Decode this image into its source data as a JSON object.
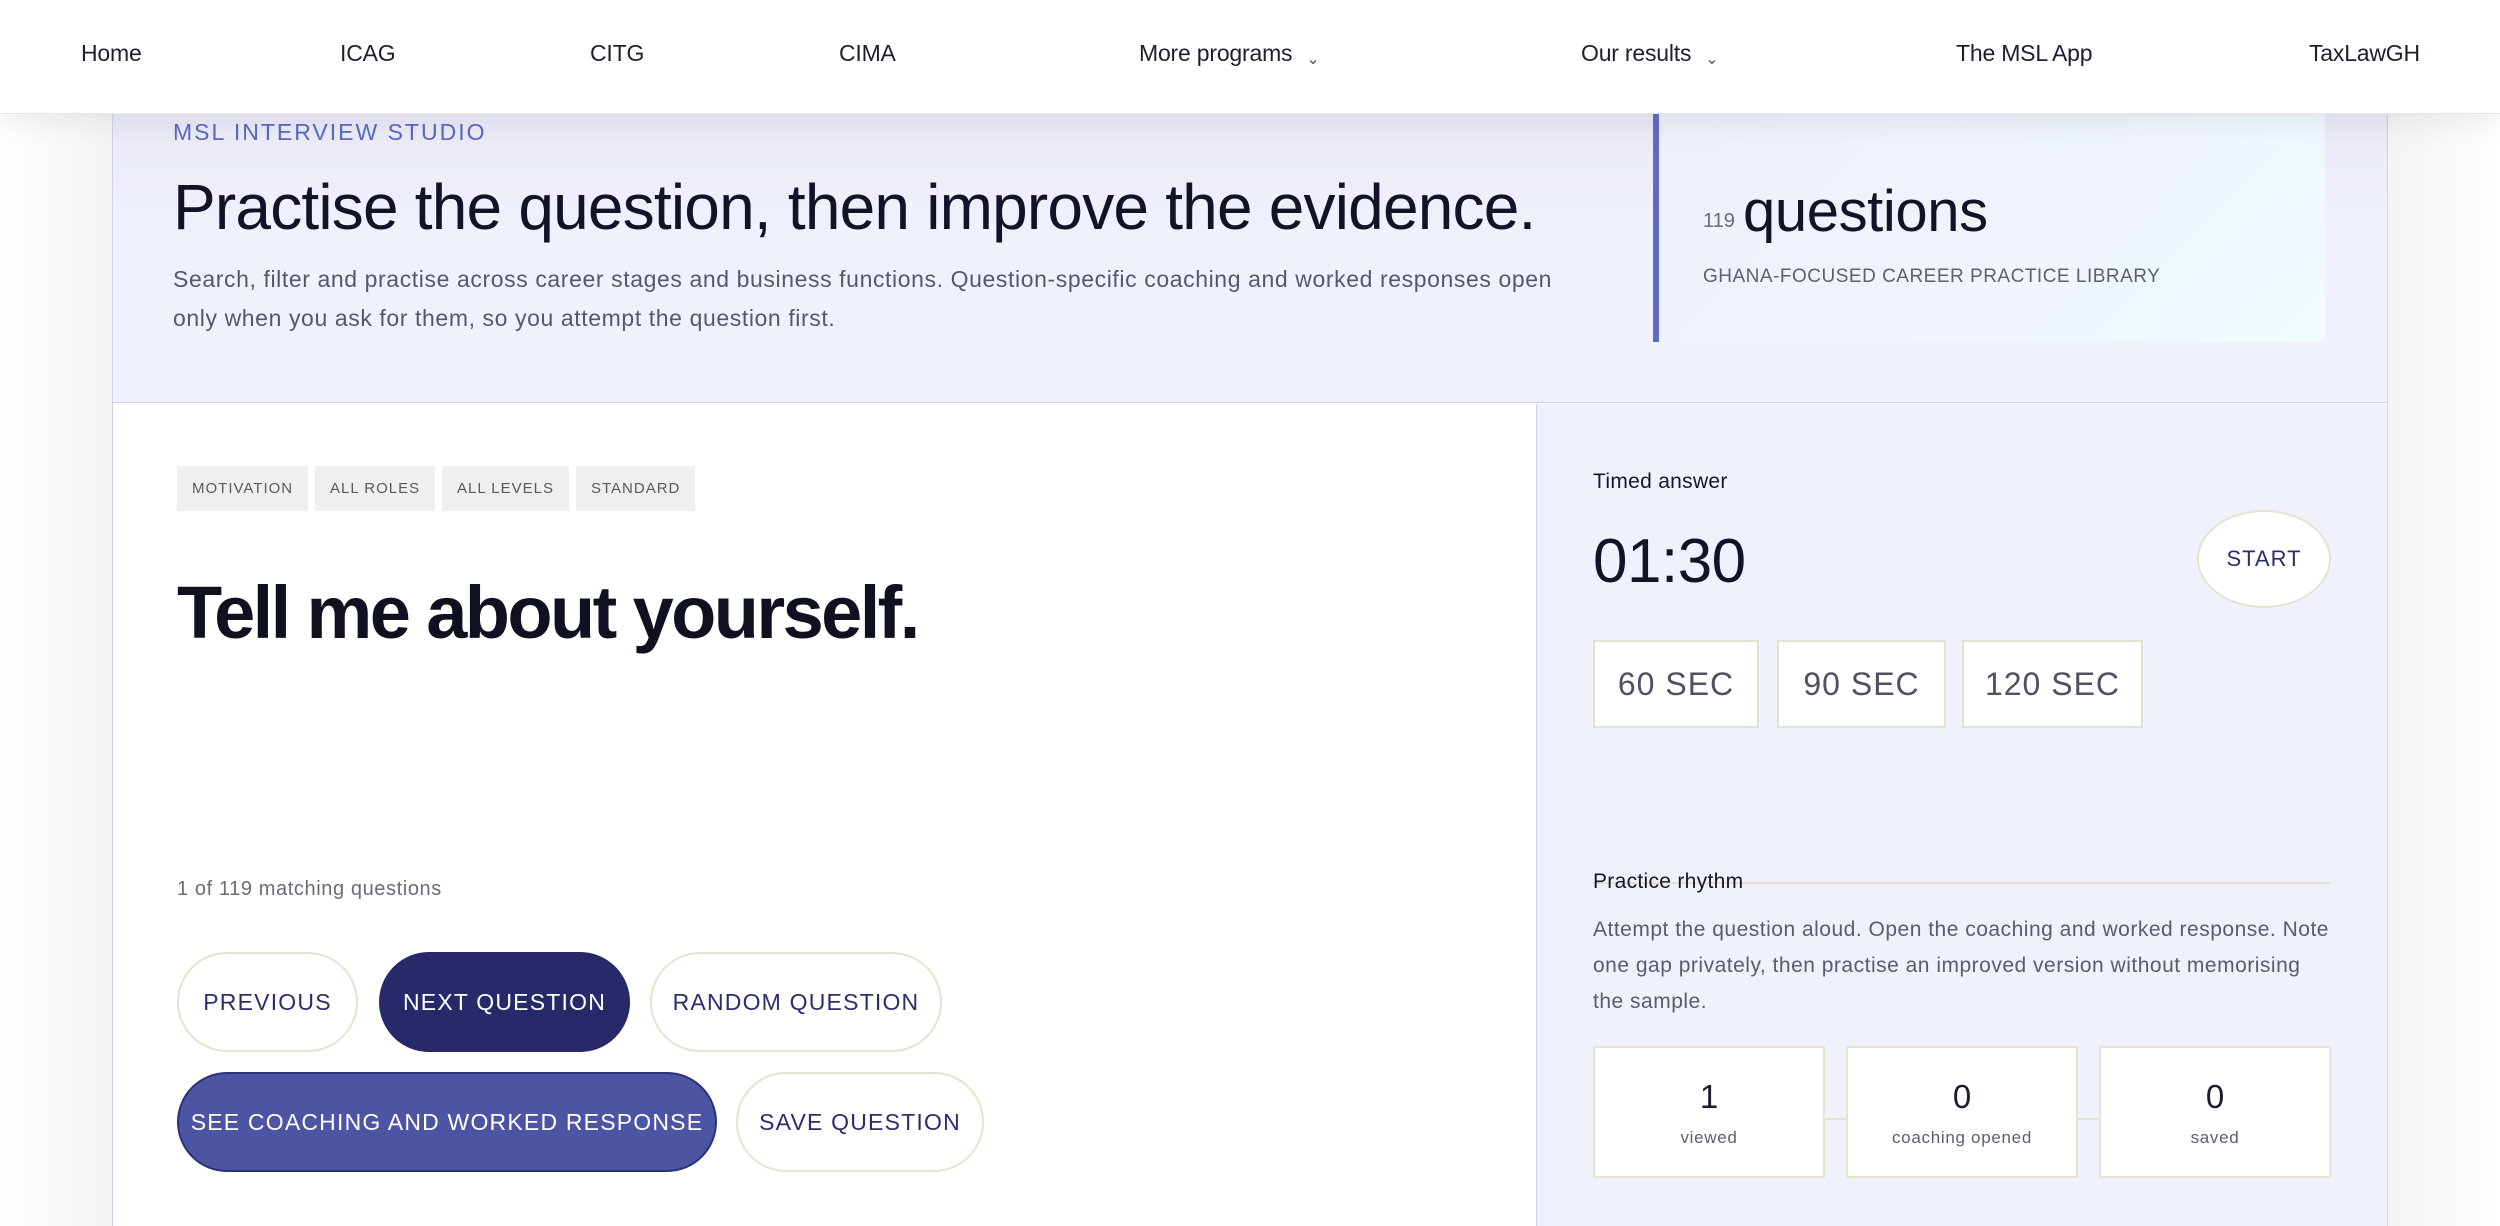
{
  "nav": {
    "items": [
      {
        "label": "Home"
      },
      {
        "label": "ICAG"
      },
      {
        "label": "CITG"
      },
      {
        "label": "CIMA"
      },
      {
        "label": "More programs",
        "dropdown": true
      },
      {
        "label": "Our results",
        "dropdown": true
      },
      {
        "label": "The MSL App"
      },
      {
        "label": "TaxLawGH"
      }
    ],
    "chevron_glyph": "⌄"
  },
  "hero": {
    "eyebrow": "MSL INTERVIEW STUDIO",
    "title": "Practise the question, then improve the evidence.",
    "description": "Search, filter and practise across career stages and business functions. Question-specific coaching and worked responses open only when you ask for them, so you attempt the question first.",
    "stat": {
      "count": "119",
      "label": "questions",
      "caption": "GHANA-FOCUSED CAREER PRACTICE LIBRARY"
    }
  },
  "question_panel": {
    "tags": [
      "MOTIVATION",
      "ALL ROLES",
      "ALL LEVELS",
      "STANDARD"
    ],
    "question": "Tell me about yourself.",
    "match_count": "1 of 119 matching questions",
    "buttons": {
      "previous": "PREVIOUS",
      "next": "NEXT QUESTION",
      "random": "RANDOM QUESTION",
      "coaching": "SEE COACHING AND WORKED RESPONSE",
      "save": "SAVE QUESTION"
    }
  },
  "timer_panel": {
    "heading": "Timed answer",
    "time": "01:30",
    "start_label": "START",
    "durations": [
      "60 SEC",
      "90 SEC",
      "120 SEC"
    ],
    "rhythm_heading": "Practice rhythm",
    "rhythm_text": "Attempt the question aloud. Open the coaching and worked response. Note one gap privately, then practise an improved version without memorising the sample.",
    "metrics": [
      {
        "value": "1",
        "label": "viewed"
      },
      {
        "value": "0",
        "label": "coaching opened"
      },
      {
        "value": "0",
        "label": "saved"
      }
    ]
  },
  "colors": {
    "accent": "#5e6cc8",
    "primary_dark": "#282969",
    "primary_indigo": "#4b55a3",
    "outline_border": "#e7e2cf"
  }
}
